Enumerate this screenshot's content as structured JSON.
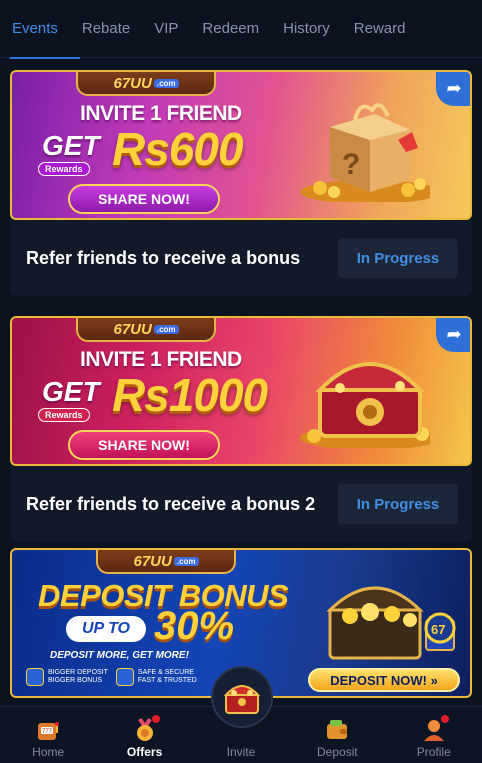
{
  "tabs": [
    {
      "label": "Events",
      "active": true
    },
    {
      "label": "Rebate",
      "active": false
    },
    {
      "label": "VIP",
      "active": false
    },
    {
      "label": "Redeem",
      "active": false
    },
    {
      "label": "History",
      "active": false
    },
    {
      "label": "Reward",
      "active": false
    }
  ],
  "brand": {
    "logo": "67UU",
    "logo_suffix": ".com"
  },
  "cards": [
    {
      "banner": {
        "invite_text": "INVITE 1 FRIEND",
        "get_text": "GET",
        "rewards_tag": "Rewards",
        "amount": "Rs600",
        "share_label": "SHARE NOW!",
        "art": "gift-box-icon"
      },
      "title": "Refer friends to receive a bonus",
      "status": "In Progress"
    },
    {
      "banner": {
        "invite_text": "INVITE 1 FRIEND",
        "get_text": "GET",
        "rewards_tag": "Rewards",
        "amount": "Rs1000",
        "share_label": "SHARE NOW!",
        "art": "treasure-chest-icon"
      },
      "title": "Refer friends to receive a bonus 2",
      "status": "In Progress"
    }
  ],
  "deposit_banner": {
    "title": "DEPOSIT BONUS",
    "up_to": "UP TO",
    "percent": "30%",
    "subtitle": "DEPOSIT MORE, GET MORE!",
    "features": [
      {
        "line1": "BIGGER DEPOSIT",
        "line2": "BIGGER BONUS",
        "icon": "gift-icon"
      },
      {
        "line1": "SAFE & SECURE",
        "line2": "FAST & TRUSTED",
        "icon": "shield-icon"
      },
      {
        "line1": "",
        "line2": "",
        "icon": "friends-icon"
      }
    ],
    "cta": "DEPOSIT NOW! »",
    "badge": "67"
  },
  "bottom_nav": [
    {
      "label": "Home",
      "icon": "slot-machine-icon",
      "active": false,
      "dot": false
    },
    {
      "label": "Offers",
      "icon": "medal-icon",
      "active": true,
      "dot": true
    },
    {
      "label": "Invite",
      "icon": "treasure-chest-icon",
      "active": false,
      "dot": false
    },
    {
      "label": "Deposit",
      "icon": "wallet-icon",
      "active": false,
      "dot": false
    },
    {
      "label": "Profile",
      "icon": "user-icon",
      "active": false,
      "dot": true
    }
  ],
  "colors": {
    "accent": "#3f8de5",
    "background": "#0b1220",
    "card": "#121a2a",
    "gold": "#ffd13a",
    "notification": "#e11d2a"
  }
}
